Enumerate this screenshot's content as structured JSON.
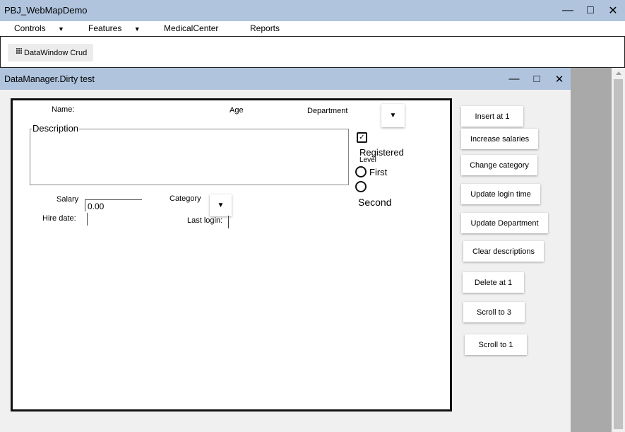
{
  "app": {
    "title": "PBJ_WebMapDemo",
    "controls": {
      "minimize": "—",
      "maximize": "□",
      "close": "✕"
    }
  },
  "menu": [
    {
      "label": "Controls",
      "arrow": "▼"
    },
    {
      "label": "Features",
      "arrow": "▼"
    },
    {
      "label": "MedicalCenter"
    },
    {
      "label": "Reports"
    }
  ],
  "toolbar": {
    "datawindow_crud": "DataWindow Crud",
    "icon": "grid-icon"
  },
  "child_window": {
    "title": "DataManager.Dirty test",
    "controls": {
      "minimize": "—",
      "maximize": "□",
      "close": "✕"
    }
  },
  "form": {
    "name_label": "Name:",
    "age_label": "Age",
    "department_label": "Department",
    "description_label": "Description",
    "registered_label": "Registered",
    "registered_checked": true,
    "level_label": "Level",
    "level_options": [
      "First",
      "Second"
    ],
    "salary_label": "Salary",
    "salary_value": "0.00",
    "category_label": "Category",
    "hire_date_label": "Hire date:",
    "last_login_label": "Last login:",
    "dropdown_arrow": "▼",
    "check_mark": "✓"
  },
  "buttons": [
    "Insert at 1",
    "Increase salaries",
    "Change category",
    "Update login time",
    "Update Department",
    "Clear descriptions",
    "Delete at 1",
    "Scroll to 3",
    "Scroll to 1"
  ]
}
